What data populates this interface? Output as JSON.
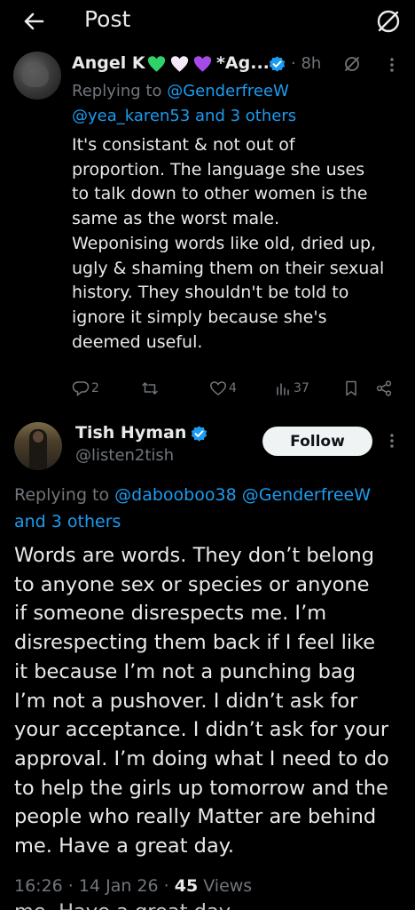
{
  "header": {
    "title": "Post"
  },
  "tweet1": {
    "name_prefix": "Angel K",
    "name_suffix": "*Ag...",
    "time": "· 8h",
    "replying_label": "Replying to",
    "replying_user": "@GenderfreeW",
    "replying_line2_user": "@yea_karen53",
    "replying_line2_rest": "and 3 others",
    "text": "It's consistant & not out of\nproportion. The language she uses\nto talk down to other women is the\nsame as the worst  male.\nWeponising words like  old, dried up,\nugly & shaming them on their sexual\nhistory.  They shouldn't be told to\nignore it simply because she's\ndeemed useful.",
    "actions": {
      "replies": "2",
      "likes": "4",
      "views": "37"
    },
    "heart_colors": [
      "#2fd16b",
      "#f3e9f7",
      "#a74be8"
    ]
  },
  "tweet2": {
    "name": "Tish Hyman",
    "handle": "@listen2tish",
    "follow_label": "Follow",
    "replying_label": "Replying to",
    "replying_user1": "@dabooboo38",
    "replying_user2": "@GenderfreeW",
    "replying_rest": "and 3 others",
    "text": "Words are words. They don’t belong\nto anyone sex or species or anyone\nif someone disrespects me. I’m\ndisrespecting them back if I feel like\nit because I’m not a punching bag\nI’m not a pushover. I didn’t ask for\nyour acceptance. I didn’t ask for your\napproval. I’m doing what I need to do\nto help the girls up tomorrow and the\npeople who really Matter are behind\nme. Have a great day.",
    "meta_time": "16:26 · 14 Jan 26 · ",
    "meta_views_count": "45",
    "meta_views_label": " Views",
    "cut_text": "me. Have a great day."
  },
  "colors": {
    "accent": "#1d9bf0",
    "muted": "#71767b",
    "text": "#e7e9ea",
    "background": "#000000"
  }
}
